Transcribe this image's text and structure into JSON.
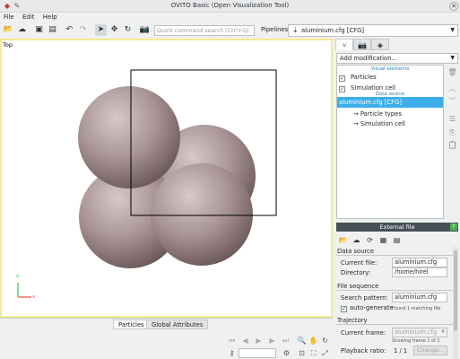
{
  "window": {
    "title": "OVITO Basic (Open Visualization Tool)"
  },
  "menu": [
    "File",
    "Edit",
    "Help"
  ],
  "toolbar": {
    "search_placeholder": "Quick command search (Ctrl+Q)",
    "pipelines_label": "Pipelines:",
    "pipeline_value": "aluminium.cfg [CFG]"
  },
  "viewport": {
    "caption": "Top",
    "axis_y": "y",
    "axis_x": "x"
  },
  "bottom_tabs": [
    "Particles",
    "Global Attributes"
  ],
  "right_panel": {
    "add_modification": "Add modification...",
    "section_visual": "Visual elements",
    "items_visual": [
      "Particles",
      "Simulation cell"
    ],
    "section_data": "Data source",
    "source_item": "aluminium.cfg [CFG]",
    "sub_items": [
      "→ Particle types",
      "→ Simulation cell"
    ]
  },
  "external_file": {
    "header": "External file",
    "help": "?",
    "data_source_title": "Data source",
    "current_file_label": "Current file:",
    "current_file_value": "aluminium.cfg",
    "directory_label": "Directory:",
    "directory_value": "/home/hirel",
    "file_sequence_title": "File sequence",
    "search_pattern_label": "Search pattern:",
    "search_pattern_value": "aluminium.cfg",
    "auto_generate_label": "auto-generate",
    "found_note": "Found 1 matching file",
    "trajectory_title": "Trajectory",
    "current_frame_label": "Current frame:",
    "current_frame_value": "aluminium.cfg",
    "showing_note": "Showing frame 1 of 1",
    "playback_label": "Playback ratio:",
    "playback_value": "1 / 1",
    "change_button": "Change..."
  },
  "colors": {
    "accent": "#3daee9",
    "viewport_border": "#f4ea92",
    "atom": "#a48f8f"
  }
}
